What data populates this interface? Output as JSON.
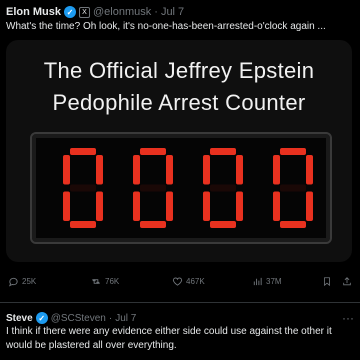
{
  "post": {
    "author_name": "Elon Musk",
    "handle": "@elonmusk",
    "separator": "·",
    "date": "Jul 7",
    "affiliation_label": "X",
    "text": "What's the time? Oh look, it's no-one-has-been-arrested-o'clock again ...",
    "more_label": "···"
  },
  "media": {
    "title_line1": "The Official Jeffrey Epstein",
    "title_line2": "Pedophile Arrest Counter",
    "counter_digits": [
      "0",
      "0",
      "0",
      "0"
    ],
    "counter_color": "#e8311f"
  },
  "actions": {
    "replies": "25K",
    "reposts": "76K",
    "likes": "467K",
    "views": "37M"
  },
  "reply": {
    "author_name": "Steve",
    "handle": "@SCSteven",
    "separator": "·",
    "date": "Jul 7",
    "more_label": "···",
    "text": "I think if there were any evidence either side could use against the other it would be plastered all over everything."
  },
  "colors": {
    "background": "#000000",
    "text": "#e7e9ea",
    "muted": "#71767b",
    "verified": "#1d9bf0"
  }
}
